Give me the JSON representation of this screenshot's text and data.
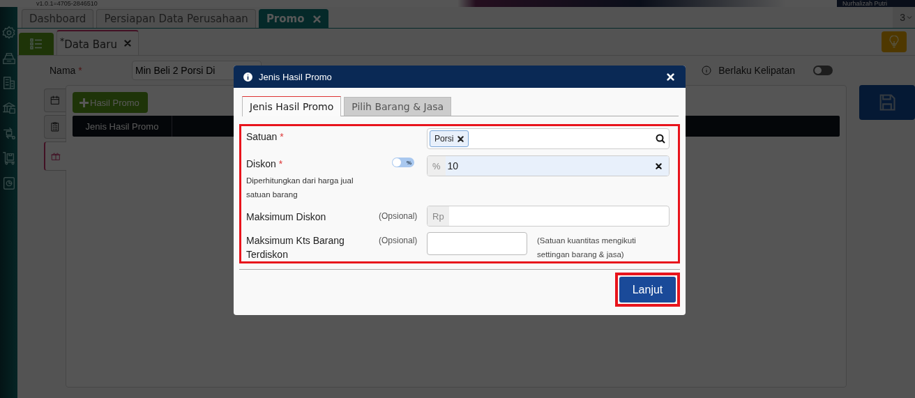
{
  "header": {
    "version": "v1.0.1=4705-2846510",
    "user_name": "Nurhalizah Putri"
  },
  "tabs": [
    {
      "label": "Dashboard",
      "selected": false,
      "closable": false
    },
    {
      "label": "Persiapan Data Perusahaan",
      "selected": false,
      "closable": false
    },
    {
      "label": "Promo",
      "selected": true,
      "closable": true
    }
  ],
  "tab_count": "3",
  "doc_tabs": [
    {
      "label": "$^{*}$Data Baru",
      "selected": true
    }
  ],
  "form": {
    "name_label": "Nama",
    "name_required_mark": "*",
    "name_value": "Min Beli 2 Porsi Di",
    "multiple_label": "Berlaku Kelipatan",
    "multiple_on": false
  },
  "side_tabs": [
    {
      "kind": "calendar",
      "selected": false
    },
    {
      "kind": "clipboard",
      "selected": false
    },
    {
      "kind": "gift",
      "selected": true
    }
  ],
  "add_button": "Hasil Promo",
  "table": {
    "columns": [
      "Jenis Hasil Promo"
    ]
  },
  "dialog": {
    "title": "Jenis Hasil Promo",
    "tabs": [
      {
        "label": "Jenis Hasil Promo",
        "selected": true
      },
      {
        "label": "Pilih Barang & Jasa",
        "selected": false
      }
    ],
    "fields": [
      {
        "kind": "tags",
        "label": "Satuan",
        "required_mark": "*",
        "tags": [
          "Porsi"
        ]
      },
      {
        "kind": "discount",
        "label": "Diskon",
        "required_mark": "*",
        "hint": "Diperhitungkan dari harga jual satuan barang",
        "toggle_label": "%",
        "toggle_on": false,
        "prefix": "%",
        "value": "10"
      },
      {
        "kind": "money",
        "label": "Maksimum Diskon",
        "optional": "(Opsional)",
        "prefix": "Rp"
      },
      {
        "kind": "qty",
        "label": "Maksimum Kts Barang Terdiskon",
        "optional": "(Opsional)",
        "note": "(Satuan kuantitas mengikuti settingan barang & jasa)"
      }
    ],
    "next_button": "Lanjut"
  }
}
